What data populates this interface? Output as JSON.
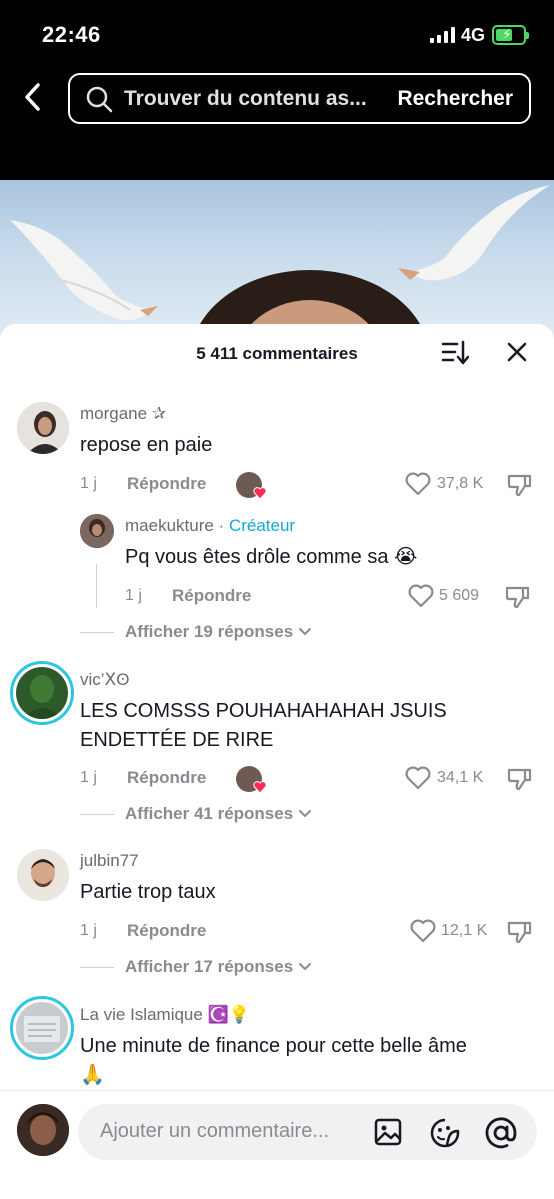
{
  "status_bar": {
    "time": "22:46",
    "network": "4G",
    "battery_level": 0.6,
    "battery_color": "#4cd964"
  },
  "header": {
    "search_placeholder": "Trouver du contenu as...",
    "search_button": "Rechercher"
  },
  "sheet": {
    "comment_count": "5 411 commentaires"
  },
  "comments": [
    {
      "username": "morgane ✰",
      "text": "repose en paie",
      "time": "1 j",
      "reply_label": "Répondre",
      "likes": "37,8 K",
      "replies": {
        "username": "maekukture",
        "separator": " · ",
        "creator_label": "Créateur",
        "text": "Pq vous êtes drôle comme sa 😭",
        "time": "1 j",
        "reply_label": "Répondre",
        "likes": "5 609"
      },
      "view_replies": "Afficher 19 réponses"
    },
    {
      "username": "vic’𝖷ʘ",
      "text_line1": "LES COMSSS POUHAHAHAHAH JSUIS",
      "text_line2": "ENDETTÉE DE RIRE",
      "time": "1 j",
      "reply_label": "Répondre",
      "likes": "34,1 K",
      "view_replies": "Afficher 41 réponses"
    },
    {
      "username": "julbin77",
      "text": "Partie trop taux",
      "time": "1 j",
      "reply_label": "Répondre",
      "likes": "12,1 K",
      "view_replies": "Afficher 17 réponses"
    },
    {
      "username": "La vie Islamique ☪️💡",
      "text_line1": "Une minute de finance pour cette belle âme",
      "text_line2": "🙏"
    }
  ],
  "input_bar": {
    "placeholder": "Ajouter un commentaire..."
  },
  "icons": {
    "back": "chevron-left-icon",
    "search": "search-icon",
    "sort": "sort-icon",
    "close": "close-icon",
    "like": "heart-outline-icon",
    "dislike": "thumbs-down-icon",
    "image": "image-icon",
    "sticker": "sticker-icon",
    "mention": "at-icon"
  },
  "colors": {
    "accent_creator": "#12a9d6",
    "story_ring": "#2ec5e0",
    "muted_text": "#8a8b91",
    "heart_badge": "#fe2c55"
  }
}
